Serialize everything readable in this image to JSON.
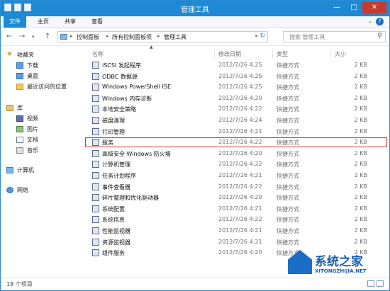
{
  "window": {
    "title": "管理工具",
    "controls": {
      "minimize": "—",
      "maximize": "□",
      "close": "✕"
    }
  },
  "ribbon": {
    "tabs": [
      "文件",
      "主页",
      "共享",
      "查看"
    ],
    "collapse_glyph": "⌄",
    "help_glyph": "?"
  },
  "nav": {
    "back": "←",
    "forward": "→",
    "dropdown": "▾",
    "up": "↑"
  },
  "address": {
    "crumbs": [
      "控制面板",
      "所有控制面板项",
      "管理工具"
    ],
    "separator": "▸",
    "dropdown": "▾",
    "refresh": "↻"
  },
  "search": {
    "placeholder": "搜索 管理工具",
    "icon": "search-icon"
  },
  "sidebar": {
    "favorites": {
      "label": "收藏夹",
      "items": [
        "下载",
        "桌面",
        "最近访问的位置"
      ]
    },
    "libraries": {
      "label": "库",
      "items": [
        "视频",
        "图片",
        "文档",
        "音乐"
      ]
    },
    "computer": "计算机",
    "network": "网络"
  },
  "columns": [
    "名称",
    "修改日期",
    "类型",
    "大小"
  ],
  "files": [
    {
      "name": "iSCSI 发起程序",
      "date": "2012/7/26 4:25",
      "type": "快捷方式",
      "size": "2 KB"
    },
    {
      "name": "ODBC 数据源",
      "date": "2012/7/26 4:25",
      "type": "快捷方式",
      "size": "2 KB"
    },
    {
      "name": "Windows PowerShell ISE",
      "date": "2012/7/26 4:25",
      "type": "快捷方式",
      "size": "2 KB"
    },
    {
      "name": "Windows 内存诊断",
      "date": "2012/7/26 4:20",
      "type": "快捷方式",
      "size": "2 KB"
    },
    {
      "name": "本地安全策略",
      "date": "2012/7/26 4:22",
      "type": "快捷方式",
      "size": "2 KB"
    },
    {
      "name": "磁盘清理",
      "date": "2012/7/26 4:24",
      "type": "快捷方式",
      "size": "2 KB"
    },
    {
      "name": "打印管理",
      "date": "2012/7/26 4:21",
      "type": "快捷方式",
      "size": "2 KB"
    },
    {
      "name": "服务",
      "date": "2012/7/26 4:22",
      "type": "快捷方式",
      "size": "2 KB",
      "highlighted": true
    },
    {
      "name": "高级安全 Windows 防火墙",
      "date": "2012/7/26 4:20",
      "type": "快捷方式",
      "size": "2 KB"
    },
    {
      "name": "计算机管理",
      "date": "2012/7/26 4:22",
      "type": "快捷方式",
      "size": "2 KB"
    },
    {
      "name": "任务计划程序",
      "date": "2012/7/26 4:21",
      "type": "快捷方式",
      "size": "2 KB"
    },
    {
      "name": "事件查看器",
      "date": "2012/7/26 4:22",
      "type": "快捷方式",
      "size": "2 KB"
    },
    {
      "name": "碎片整理和优化驱动器",
      "date": "2012/7/26 4:20",
      "type": "快捷方式",
      "size": "2 KB"
    },
    {
      "name": "系统配置",
      "date": "2012/7/26 4:21",
      "type": "快捷方式",
      "size": "2 KB"
    },
    {
      "name": "系统信息",
      "date": "2012/7/26 4:22",
      "type": "快捷方式",
      "size": "2 KB"
    },
    {
      "name": "性能监视器",
      "date": "2012/7/26 4:21",
      "type": "快捷方式",
      "size": "2 KB"
    },
    {
      "name": "资源监视器",
      "date": "2012/7/26 4:21",
      "type": "快捷方式",
      "size": "2 KB"
    },
    {
      "name": "组件服务",
      "date": "2012/7/26 4:20",
      "type": "快捷方式",
      "size": "2 KB"
    }
  ],
  "status": {
    "item_count": "18 个项目"
  },
  "watermark": {
    "brand": "系统之家",
    "url": "XITONGZHIJIA.NET"
  },
  "colors": {
    "accent": "#1e89d4",
    "highlight": "#e0302c",
    "close": "#c73b2f"
  }
}
